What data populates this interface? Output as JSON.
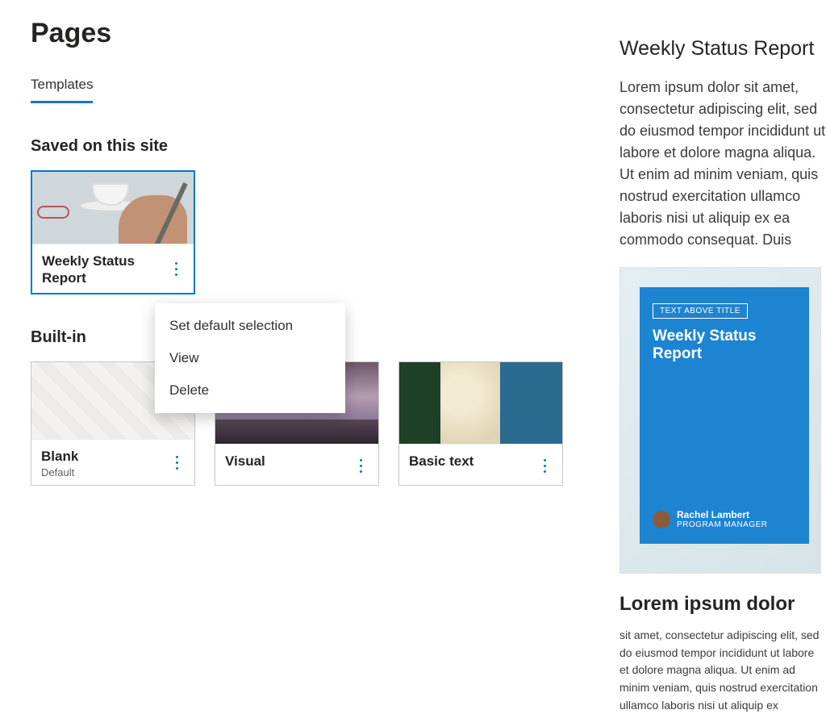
{
  "page": {
    "title": "Pages"
  },
  "tabs": [
    {
      "label": "Templates",
      "active": true
    }
  ],
  "sections": {
    "saved": {
      "heading": "Saved on this site",
      "items": [
        {
          "title": "Weekly Status Report"
        }
      ]
    },
    "builtin": {
      "heading": "Built-in",
      "items": [
        {
          "title": "Blank",
          "subtitle": "Default"
        },
        {
          "title": "Visual"
        },
        {
          "title": "Basic text"
        }
      ]
    }
  },
  "context_menu": {
    "items": [
      {
        "label": "Set default selection"
      },
      {
        "label": "View"
      },
      {
        "label": "Delete"
      }
    ]
  },
  "preview": {
    "title": "Weekly Status Report",
    "paragraph": "Lorem ipsum dolor sit amet, consectetur adipiscing elit, sed do eiusmod tempor incididunt ut labore et dolore magna aliqua. Ut enim ad minim veniam, quis nostrud exercitation ullamco laboris nisi ut aliquip ex ea commodo consequat. Duis",
    "card": {
      "tag": "TEXT ABOVE TITLE",
      "title": "Weekly Status Report",
      "person_name": "Rachel Lambert",
      "person_role": "PROGRAM MANAGER"
    },
    "h2": "Lorem ipsum dolor",
    "p2": "sit amet, consectetur adipiscing elit, sed do eiusmod tempor incididunt ut labore et dolore magna aliqua. Ut enim ad minim veniam, quis nostrud exercitation ullamco laboris nisi ut aliquip ex"
  }
}
